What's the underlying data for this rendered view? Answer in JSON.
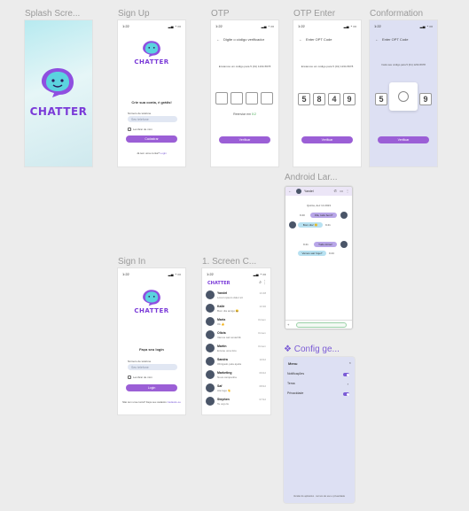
{
  "frames": {
    "splash": {
      "label": "Splash Scre...",
      "brand": "CHATTER"
    },
    "signup": {
      "label": "Sign Up",
      "time": "1:22",
      "brand": "CHATTER",
      "heading": "Crie sua conta, é grátis!",
      "field_label": "Número de telefone",
      "phone_placeholder": "Seu telefone",
      "remember": "Lembrar de mim",
      "button": "Cadastrar",
      "footer_text": "Já tem uma conta?",
      "footer_link": "Login"
    },
    "otp": {
      "label": "OTP",
      "time": "1:22",
      "title": "Digite o código verificador",
      "info": "Enviamos um código para 5 (01) 1234-5678",
      "resend_text": "Reenviar em",
      "resend_count": "0:2",
      "button": "Verificar"
    },
    "otp_enter": {
      "label": "OTP Enter",
      "time": "1:22",
      "title": "Enter OPT Code",
      "info": "Enviamos um código para 5 (01) 1234-5678",
      "digits": [
        "5",
        "8",
        "4",
        "9"
      ],
      "button": "Verificar"
    },
    "confirmation": {
      "label": "Conformation",
      "time": "1:22",
      "title": "Enter OPT Code",
      "info": "Insira seu código para 5 (01) 1234-5678",
      "digit_left": "5",
      "digit_right": "9",
      "button": "Verificar"
    },
    "android": {
      "label": "Android Lar...",
      "contact": "Yandel",
      "date_label": "Quinta, dez 14 2023",
      "bubbles": [
        {
          "text": "Olá, tudo bem?",
          "time": "9:40"
        },
        {
          "text": "Bom dia! 😊",
          "time": "9:41"
        },
        {
          "text": "Tudo ótimo!",
          "time": "9:41"
        },
        {
          "text": "Vamos sair hoje?",
          "time": "9:43"
        }
      ]
    },
    "signin": {
      "label": "Sign In",
      "time": "1:22",
      "brand": "CHATTER",
      "heading": "Faça seu login",
      "field_label": "Número de telefone",
      "phone_placeholder": "Seu telefone",
      "remember": "Lembrar de mim",
      "button": "Login",
      "footer_text": "Não tem uma conta? Faça seu cadastro",
      "footer_link": "Cadastre-se"
    },
    "chats": {
      "label": "1. Screen  C...",
      "time": "1:22",
      "brand": "CHATTER",
      "rows": [
        {
          "name": "Yandel",
          "msg": "Lorem ipsum dolor sit",
          "time": "13:48"
        },
        {
          "name": "Kalle",
          "msg": "Bom dia amigo 😀",
          "time": "13:30"
        },
        {
          "name": "Maria",
          "msg": "Ok 👍",
          "time": "Ontem"
        },
        {
          "name": "Olivia",
          "msg": "Vamos sair amanhã",
          "time": "Ontem"
        },
        {
          "name": "Martin",
          "msg": "Enviou uma foto",
          "time": "Ontem"
        },
        {
          "name": "Sandra",
          "msg": "Obrigado pela ajuda",
          "time": "10/12"
        },
        {
          "name": "Marketing",
          "msg": "Nova campanha",
          "time": "09/12"
        },
        {
          "name": "Saf",
          "msg": "Até logo 👋",
          "time": "08/12"
        },
        {
          "name": "Stephen",
          "msg": "Te vejo lá",
          "time": "07/12"
        }
      ]
    },
    "config": {
      "label": "❖ Config ge...",
      "title": "Menu",
      "rows": [
        {
          "label": "Notificações"
        },
        {
          "label": "Tema"
        },
        {
          "label": "Privacidade"
        }
      ],
      "footer": "Versão do aplicativo · termos de uso e privacidade"
    }
  },
  "colors": {
    "brand": "#7a3ad8",
    "button": "#9b5fd6",
    "lavender": "#dde0f3",
    "page_bg": "#ececec"
  }
}
